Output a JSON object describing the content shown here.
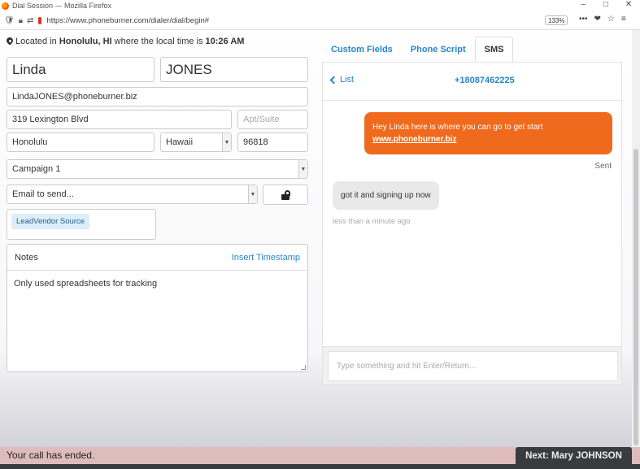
{
  "window": {
    "title": "Dial Session — Mozilla Firefox",
    "url": "https://www.phoneburner.com/dialer/dial/begin#",
    "zoom": "133%",
    "minimize": "–",
    "maximize": "□",
    "close": "✕"
  },
  "location": {
    "prefix": "Located in ",
    "city": "Honolulu, HI",
    "middle": " where the local time is ",
    "time": "10:26 AM"
  },
  "contact": {
    "first_name": "Linda",
    "last_name": "JONES",
    "email": "LindaJONES@phoneburner.biz",
    "address": "319 Lexington Blvd",
    "apt_placeholder": "Apt/Suite",
    "city": "Honolulu",
    "state": "Hawaii",
    "zip": "96818",
    "campaign": "Campaign 1",
    "email_to_send": "Email to send...",
    "tag": "LeadVendor Source"
  },
  "notes": {
    "title": "Notes",
    "insert_timestamp": "Insert Timestamp",
    "body": "Only used spreadsheets for tracking"
  },
  "tabs": [
    {
      "label": "Custom Fields"
    },
    {
      "label": "Phone Script"
    },
    {
      "label": "SMS"
    }
  ],
  "sms": {
    "back_label": "List",
    "phone": "+18087462225",
    "outgoing_text": "Hey Linda here is where you can go to get start",
    "outgoing_link": "www.phoneburner.biz",
    "sent_label": "Sent",
    "incoming_text": "got it and signing up now",
    "incoming_time": "less than a minute ago",
    "compose_placeholder": "Type something and hit Enter/Return..."
  },
  "status": {
    "message": "Your call has ended.",
    "next_label": "Next: Mary JOHNSON"
  }
}
